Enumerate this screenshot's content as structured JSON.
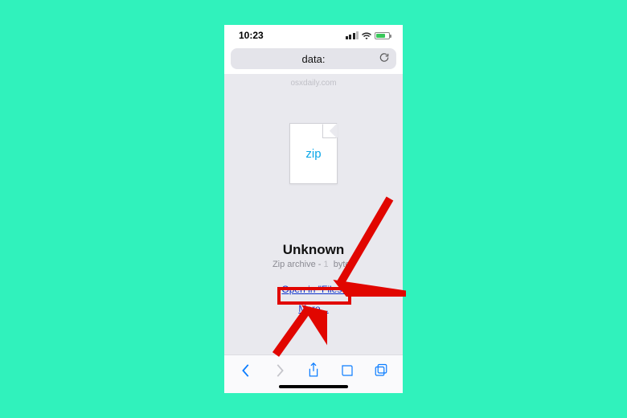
{
  "statusbar": {
    "time": "10:23"
  },
  "urlbar": {
    "text": "data:"
  },
  "page": {
    "watermark": "osxdaily.com",
    "file_ext": "zip",
    "file_title": "Unknown",
    "file_sub_prefix": "Zip archive - ",
    "file_sub_suffix": "bytes",
    "open_in_files": "Open in \"Files\"",
    "more": "More..."
  },
  "annotation": {
    "highlight_color": "#e10600"
  }
}
